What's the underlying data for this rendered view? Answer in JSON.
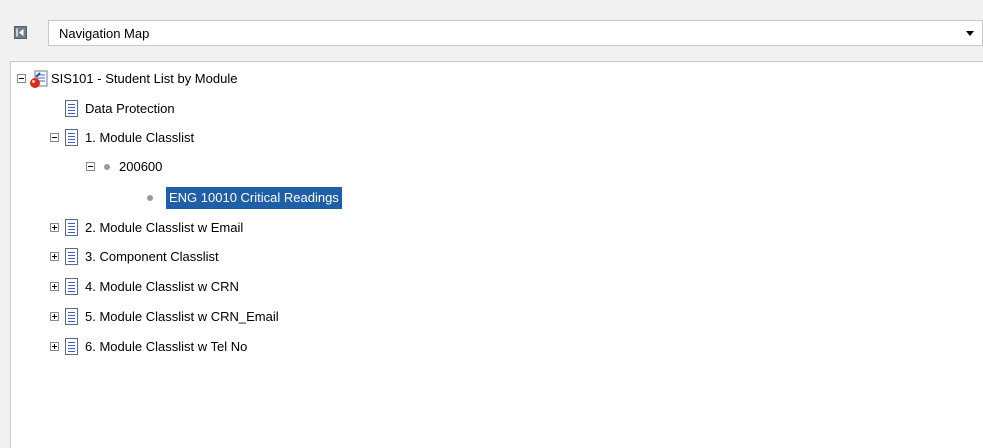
{
  "header": {
    "dropdown_value": "Navigation Map"
  },
  "tree": {
    "root_label": "SIS101 - Student List by Module",
    "data_protection_label": "Data Protection",
    "module_classlist_label": "1. Module Classlist",
    "year_label": "200600",
    "selected_module_label": "ENG 10010 Critical Readings",
    "item2_label": "2. Module Classlist w Email",
    "item3_label": "3. Component Classlist",
    "item4_label": "4. Module Classlist w CRN",
    "item5_label": "5. Module Classlist w CRN_Email",
    "item6_label": "6. Module Classlist w Tel No"
  },
  "colors": {
    "selection_background": "#1f5fa8",
    "doc_icon_blue": "#3b5fcf"
  },
  "icons": {
    "collapse": "collapse-panel-icon",
    "dropdown": "chevron-down-icon",
    "report": "report-icon",
    "document": "document-icon",
    "bullet": "bullet-icon"
  }
}
